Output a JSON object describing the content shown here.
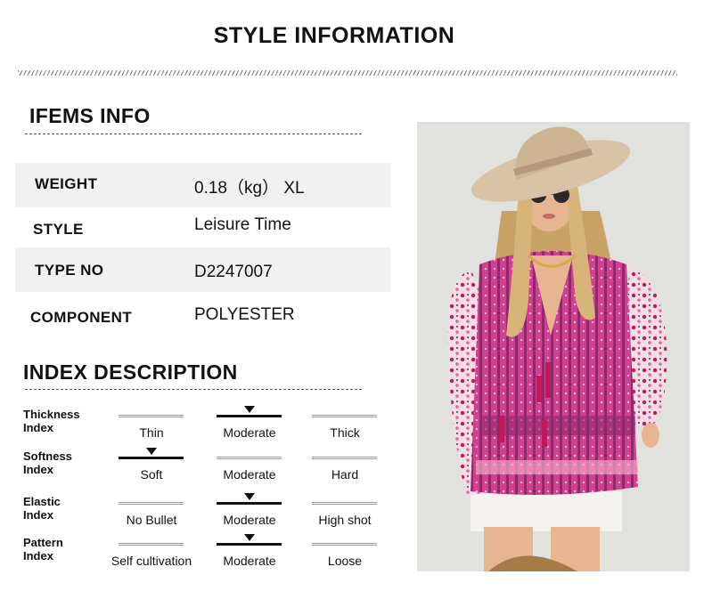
{
  "page": {
    "title": "STYLE INFORMATION"
  },
  "items_info": {
    "heading": "IFEMS INFO",
    "rows": [
      {
        "label": "WEIGHT",
        "value": "0.18（kg） XL"
      },
      {
        "label": "STYLE",
        "value": "Leisure Time"
      },
      {
        "label": "TYPE NO",
        "value": "D2247007"
      },
      {
        "label": "COMPONENT",
        "value": "POLYESTER"
      }
    ]
  },
  "index_description": {
    "heading": "INDEX DESCRIPTION",
    "rows": [
      {
        "label_line1": "Thickness",
        "label_line2": "Index",
        "options": [
          "Thin",
          "Moderate",
          "Thick"
        ],
        "selected": 1
      },
      {
        "label_line1": "Softness",
        "label_line2": "Index",
        "options": [
          "Soft",
          "Moderate",
          "Hard"
        ],
        "selected": 0
      },
      {
        "label_line1": "Elastic",
        "label_line2": "Index",
        "options": [
          "No Bullet",
          "Moderate",
          "High shot"
        ],
        "selected": 1
      },
      {
        "label_line1": "Pattern",
        "label_line2": "Index",
        "options": [
          "Self cultivation",
          "Moderate",
          "Loose"
        ],
        "selected": 1
      }
    ]
  },
  "photo": {
    "colors": {
      "wall": "#e4e4e2",
      "blouse": "#d63d8f",
      "hat": "#d8c3a6",
      "hair": "#d6b47a",
      "skin": "#e8b592"
    }
  }
}
